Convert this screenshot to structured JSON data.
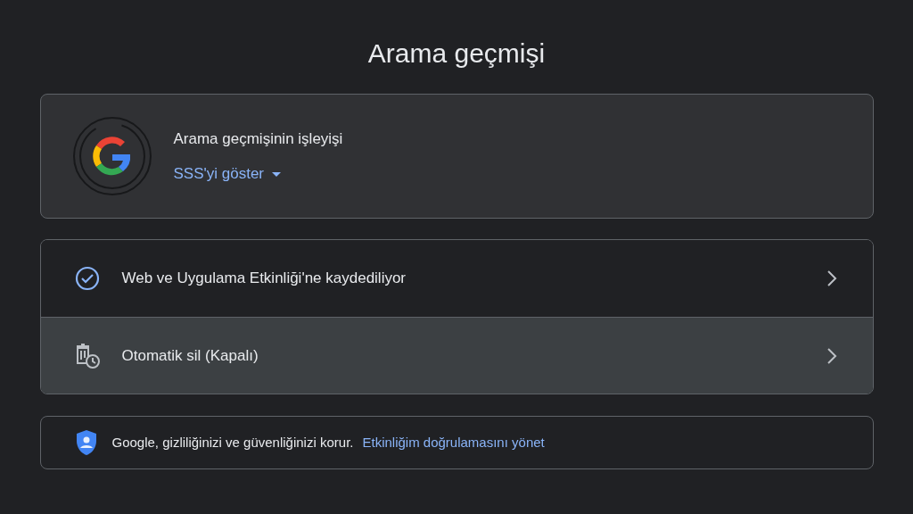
{
  "title": "Arama geçmişi",
  "info_card": {
    "heading": "Arama geçmişinin işleyişi",
    "faq_link": "SSS'yi göster"
  },
  "settings": [
    {
      "kind": "check",
      "label": "Web ve Uygulama Etkinliği'ne kaydediliyor",
      "highlighted": false
    },
    {
      "kind": "auto-delete",
      "label": "Otomatik sil (Kapalı)",
      "highlighted": true
    }
  ],
  "privacy": {
    "text": "Google, gizliliğinizi ve güvenliğinizi korur.",
    "link": "Etkinliğim doğrulamasını yönet"
  }
}
